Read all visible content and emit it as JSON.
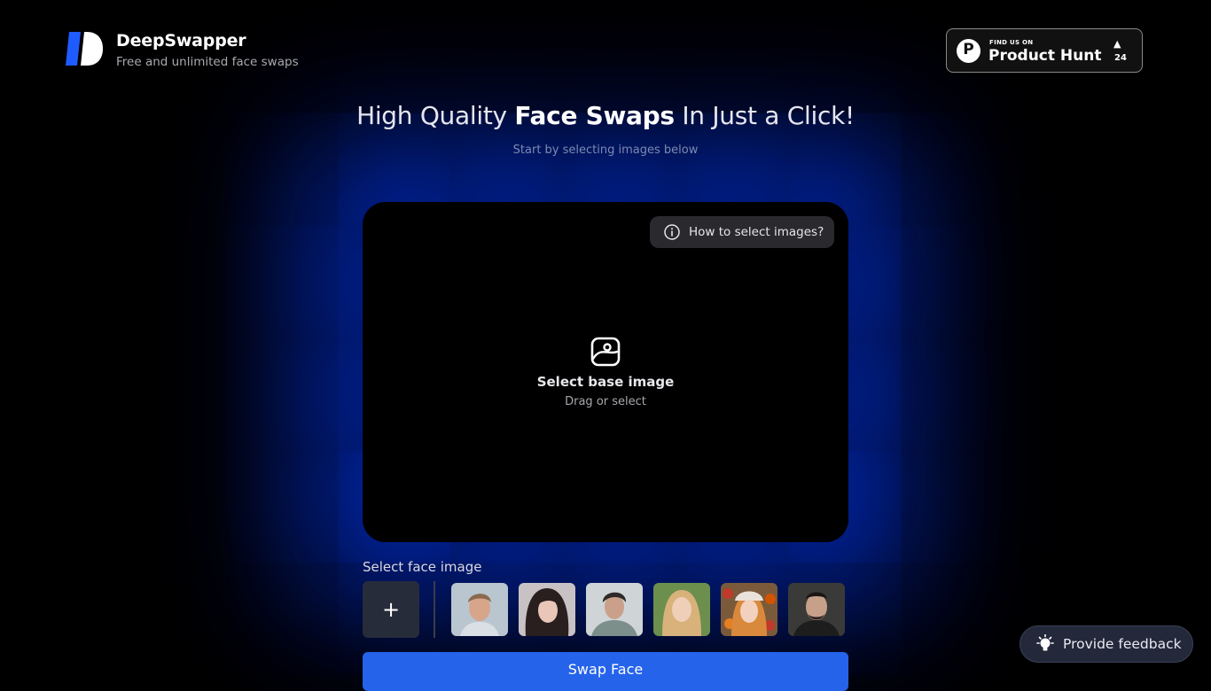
{
  "brand": {
    "title": "DeepSwapper",
    "subtitle": "Free and unlimited face swaps"
  },
  "product_hunt": {
    "find_us": "FIND US ON",
    "name": "Product Hunt",
    "logo_letter": "P",
    "upvote_arrow": "▲",
    "upvotes": "24"
  },
  "hero": {
    "headline_part1": "High Quality ",
    "headline_bold": "Face Swaps",
    "headline_part2": " In Just a Click!",
    "subline": "Start by selecting images below"
  },
  "dropzone": {
    "help_label": "How to select images?",
    "title": "Select base image",
    "subtitle": "Drag or select"
  },
  "faces": {
    "label": "Select face image",
    "add_symbol": "+",
    "thumbnails": [
      "face-1",
      "face-2",
      "face-3",
      "face-4",
      "face-5",
      "face-6"
    ]
  },
  "actions": {
    "swap_label": "Swap Face",
    "feedback_label": "Provide feedback"
  },
  "colors": {
    "accent": "#2563eb",
    "glow": "#003cff",
    "background": "#000000"
  },
  "icons": {
    "help": "info-icon",
    "dropzone": "image-icon",
    "feedback": "lightbulb-icon"
  }
}
